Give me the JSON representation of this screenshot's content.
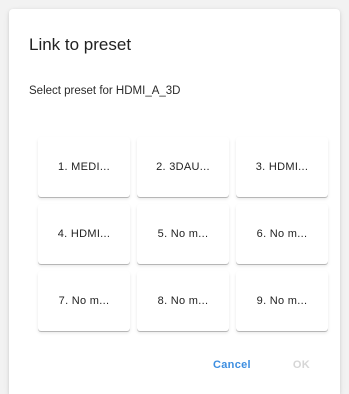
{
  "dialog": {
    "title": "Link to preset",
    "subtitle": "Select preset for HDMI_A_3D"
  },
  "presets": [
    {
      "label": "1. MEDI..."
    },
    {
      "label": "2. 3DAU..."
    },
    {
      "label": "3. HDMI..."
    },
    {
      "label": "4. HDMI..."
    },
    {
      "label": "5. No m..."
    },
    {
      "label": "6. No m..."
    },
    {
      "label": "7. No m..."
    },
    {
      "label": "8. No m..."
    },
    {
      "label": "9. No m..."
    }
  ],
  "actions": {
    "cancel_label": "Cancel",
    "confirm_label": "OK"
  },
  "colors": {
    "accent": "#3d8ee0",
    "disabled": "#d6d6d6"
  }
}
